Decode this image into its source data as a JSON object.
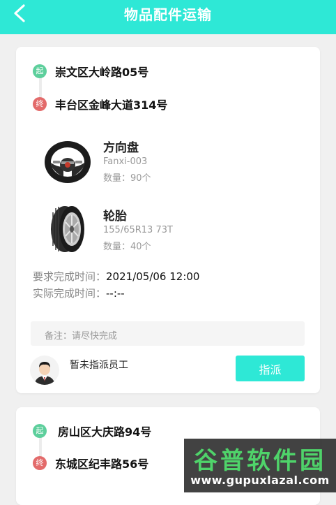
{
  "header": {
    "title": "物品配件运输",
    "back_icon": "chevron-left-icon",
    "color": "#2ee8d6"
  },
  "orders": [
    {
      "start_badge": "起",
      "start": "崇文区大岭路05号",
      "end_badge": "终",
      "end": "丰台区金峰大道314号",
      "items": [
        {
          "name": "方向盘",
          "model": "Fanxi-003",
          "qty": "数量：90个",
          "icon": "steering-wheel-icon"
        },
        {
          "name": "轮胎",
          "model": "155/65R13 73T",
          "qty": "数量：40个",
          "icon": "tire-icon"
        }
      ],
      "required_time_label": "要求完成时间：",
      "required_time": "2021/05/06 12:00",
      "actual_time_label": "实际完成时间：",
      "actual_time": "--:--",
      "remark": "备注：请尽快完成",
      "staff_status": "暂未指派员工",
      "assign_label": "指派"
    },
    {
      "start_badge": "起",
      "start": "房山区大庆路94号",
      "end_badge": "终",
      "end": "东城区纪丰路56号"
    }
  ],
  "watermark": {
    "title": "谷普软件园",
    "url": "www.gupuxlazal.com"
  },
  "colors": {
    "accent": "#2ee8d6",
    "start_badge": "#5dcf9c",
    "end_badge": "#e36b6b"
  }
}
